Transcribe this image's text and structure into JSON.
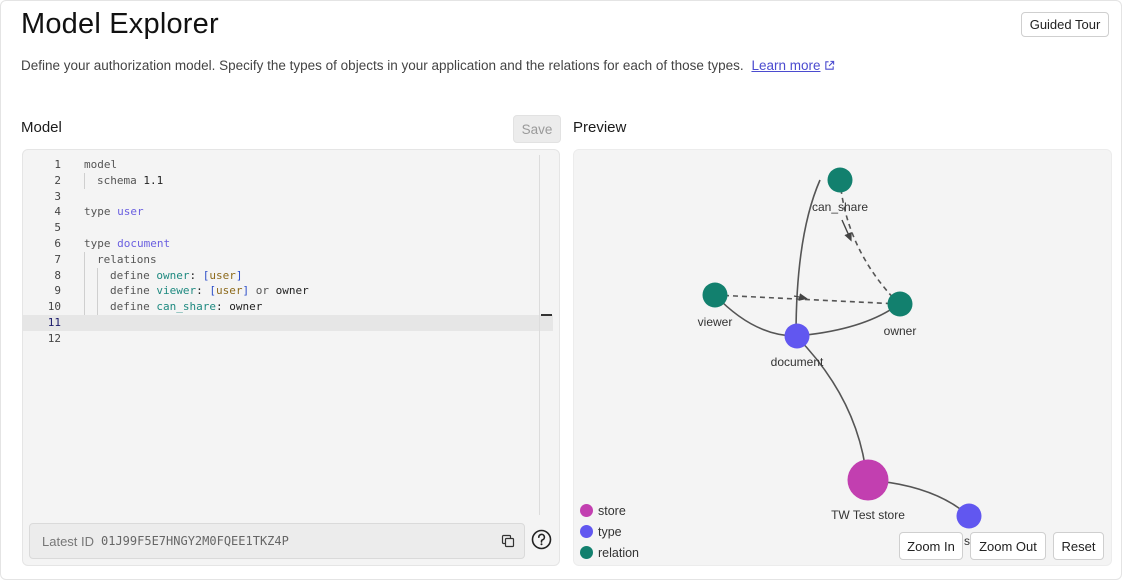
{
  "header": {
    "title": "Model Explorer",
    "guided_tour_label": "Guided Tour",
    "description": "Define your authorization model. Specify the types of objects in your application and the relations for each of those types.",
    "learn_more_label": "Learn more"
  },
  "model_panel": {
    "title": "Model",
    "save_label": "Save",
    "active_line": 11,
    "code_lines": [
      {
        "n": "1",
        "indent": 0,
        "tokens": [
          {
            "t": "model",
            "c": "k-kw"
          }
        ]
      },
      {
        "n": "2",
        "indent": 1,
        "tokens": [
          {
            "t": "schema ",
            "c": "k-kw"
          },
          {
            "t": "1.1",
            "c": ""
          }
        ]
      },
      {
        "n": "3",
        "indent": 0,
        "tokens": []
      },
      {
        "n": "4",
        "indent": 0,
        "tokens": [
          {
            "t": "type ",
            "c": "k-kw"
          },
          {
            "t": "user",
            "c": "k-type"
          }
        ]
      },
      {
        "n": "5",
        "indent": 0,
        "tokens": []
      },
      {
        "n": "6",
        "indent": 0,
        "tokens": [
          {
            "t": "type ",
            "c": "k-kw"
          },
          {
            "t": "document",
            "c": "k-type"
          }
        ]
      },
      {
        "n": "7",
        "indent": 1,
        "tokens": [
          {
            "t": "relations",
            "c": "k-kw"
          }
        ]
      },
      {
        "n": "8",
        "indent": 2,
        "tokens": [
          {
            "t": "define ",
            "c": "k-kw"
          },
          {
            "t": "owner",
            "c": "k-rel"
          },
          {
            "t": ": ",
            "c": ""
          },
          {
            "t": "[",
            "c": "k-br"
          },
          {
            "t": "user",
            "c": "k-usr"
          },
          {
            "t": "]",
            "c": "k-br"
          }
        ]
      },
      {
        "n": "9",
        "indent": 2,
        "tokens": [
          {
            "t": "define ",
            "c": "k-kw"
          },
          {
            "t": "viewer",
            "c": "k-rel"
          },
          {
            "t": ": ",
            "c": ""
          },
          {
            "t": "[",
            "c": "k-br"
          },
          {
            "t": "user",
            "c": "k-usr"
          },
          {
            "t": "]",
            "c": "k-br"
          },
          {
            "t": " or ",
            "c": "k-kw"
          },
          {
            "t": "owner",
            "c": ""
          }
        ]
      },
      {
        "n": "10",
        "indent": 2,
        "tokens": [
          {
            "t": "define ",
            "c": "k-kw"
          },
          {
            "t": "can_share",
            "c": "k-rel"
          },
          {
            "t": ": ",
            "c": ""
          },
          {
            "t": "owner",
            "c": ""
          }
        ]
      },
      {
        "n": "11",
        "indent": 0,
        "tokens": []
      },
      {
        "n": "12",
        "indent": 0,
        "tokens": []
      }
    ],
    "latest_id_label": "Latest ID",
    "latest_id_value": "01J99F5E7HNGY2M0FQEE1TKZ4P"
  },
  "preview_panel": {
    "title": "Preview",
    "nodes": [
      {
        "id": "can_share",
        "label": "can_share",
        "kind": "relation"
      },
      {
        "id": "viewer",
        "label": "viewer",
        "kind": "relation"
      },
      {
        "id": "owner",
        "label": "owner",
        "kind": "relation"
      },
      {
        "id": "document",
        "label": "document",
        "kind": "type"
      },
      {
        "id": "store",
        "label": "TW Test store",
        "kind": "store"
      },
      {
        "id": "user",
        "label": "s",
        "kind": "type"
      }
    ],
    "legend": [
      {
        "label": "store",
        "color": "#c23fb0"
      },
      {
        "label": "type",
        "color": "#6157f0"
      },
      {
        "label": "relation",
        "color": "#12806e"
      }
    ],
    "zoom_in_label": "Zoom In",
    "zoom_out_label": "Zoom Out",
    "reset_label": "Reset"
  }
}
